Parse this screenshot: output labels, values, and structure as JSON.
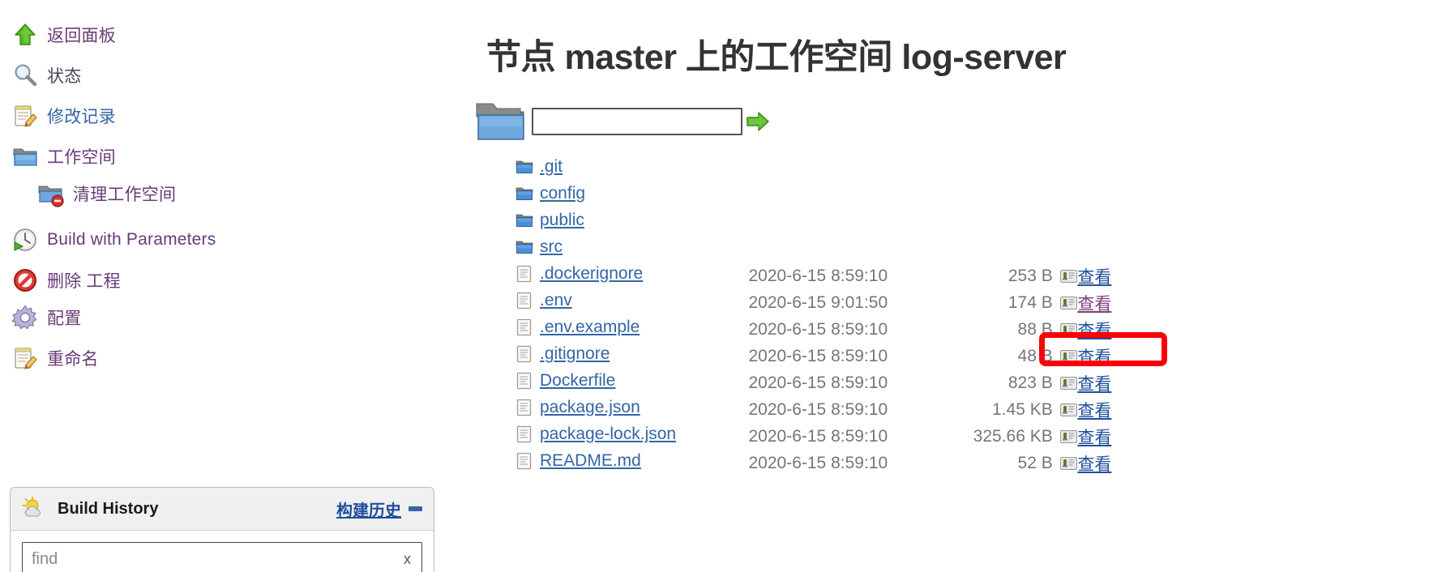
{
  "sidebar": {
    "tasks": [
      {
        "label": "返回面板",
        "icon": "up-arrow-icon",
        "color": "visited"
      },
      {
        "label": "状态",
        "icon": "magnifier-icon",
        "color": "dark"
      },
      {
        "label": "修改记录",
        "icon": "notepad-pencil-icon",
        "color": "blue"
      },
      {
        "label": "工作空间",
        "icon": "folder-icon",
        "color": "visited"
      },
      {
        "label": "清理工作空间",
        "icon": "folder-delete-icon",
        "color": "visited"
      },
      {
        "label": "Build with Parameters",
        "icon": "clock-play-icon",
        "color": "visited"
      },
      {
        "label": "删除 工程",
        "icon": "no-entry-icon",
        "color": "visited"
      },
      {
        "label": "配置",
        "icon": "gear-icon",
        "color": "visited"
      },
      {
        "label": "重命名",
        "icon": "notepad-pencil-icon",
        "color": "visited"
      }
    ],
    "build_history": {
      "title": "Build History",
      "link_label": "构建历史",
      "icon": "weather-sun-cloud-icon",
      "collapse_icon": "minus-icon",
      "find_placeholder": "find",
      "find_value": "",
      "clear_label": "x"
    }
  },
  "main": {
    "title": "节点 master 上的工作空间 log-server",
    "path_input_value": "",
    "path_input_placeholder": "",
    "go_icon": "green-arrow-icon",
    "folder_icon": "folder-open-icon",
    "view_label": "查看",
    "directories": [
      {
        "name": ".git"
      },
      {
        "name": "config"
      },
      {
        "name": "public"
      },
      {
        "name": "src"
      }
    ],
    "files": [
      {
        "name": ".dockerignore",
        "date": "2020-6-15 8:59:10",
        "size": "253 B",
        "view": "查看",
        "view_visited": false
      },
      {
        "name": ".env",
        "date": "2020-6-15 9:01:50",
        "size": "174 B",
        "view": "查看",
        "view_visited": true
      },
      {
        "name": ".env.example",
        "date": "2020-6-15 8:59:10",
        "size": "88 B",
        "view": "查看",
        "view_visited": false
      },
      {
        "name": ".gitignore",
        "date": "2020-6-15 8:59:10",
        "size": "48 B",
        "view": "查看",
        "view_visited": false
      },
      {
        "name": "Dockerfile",
        "date": "2020-6-15 8:59:10",
        "size": "823 B",
        "view": "查看",
        "view_visited": false
      },
      {
        "name": "package.json",
        "date": "2020-6-15 8:59:10",
        "size": "1.45 KB",
        "view": "查看",
        "view_visited": false
      },
      {
        "name": "package-lock.json",
        "date": "2020-6-15 8:59:10",
        "size": "325.66 KB",
        "view": "查看",
        "view_visited": false
      },
      {
        "name": "README.md",
        "date": "2020-6-15 8:59:10",
        "size": "52 B",
        "view": "查看",
        "view_visited": false
      }
    ],
    "highlight": {
      "target": ".env",
      "color": "#fb0007"
    }
  }
}
